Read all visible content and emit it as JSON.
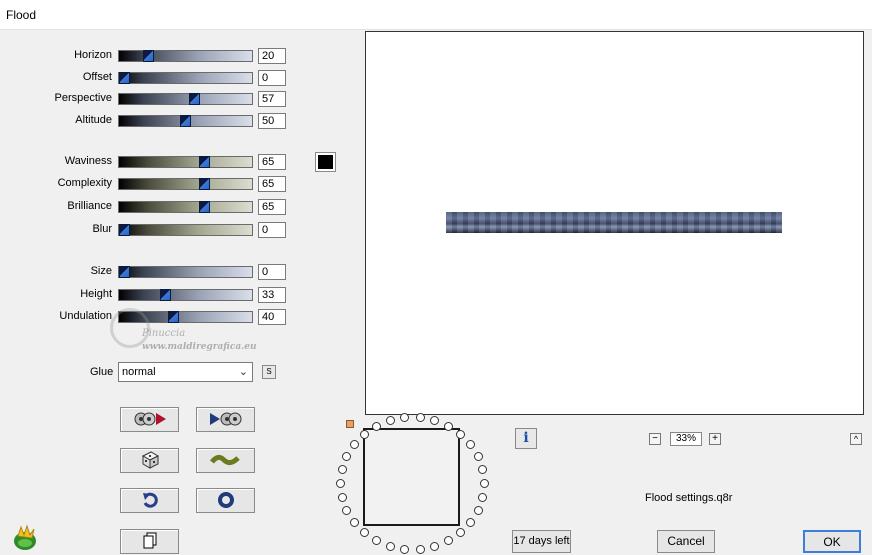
{
  "window": {
    "title": "Flood"
  },
  "sliders_group1": [
    {
      "label": "Horizon",
      "value": "20",
      "style": "blue"
    },
    {
      "label": "Offset",
      "value": "0",
      "style": "blue"
    },
    {
      "label": "Perspective",
      "value": "57",
      "style": "blue"
    },
    {
      "label": "Altitude",
      "value": "50",
      "style": "blue"
    }
  ],
  "sliders_group2": [
    {
      "label": "Waviness",
      "value": "65",
      "style": "olive"
    },
    {
      "label": "Complexity",
      "value": "65",
      "style": "olive"
    },
    {
      "label": "Brilliance",
      "value": "65",
      "style": "olive"
    },
    {
      "label": "Blur",
      "value": "0",
      "style": "olive"
    }
  ],
  "sliders_group3": [
    {
      "label": "Size",
      "value": "0",
      "style": "blue"
    },
    {
      "label": "Height",
      "value": "33",
      "style": "blue"
    },
    {
      "label": "Undulation",
      "value": "40",
      "style": "blue"
    }
  ],
  "color_swatch": "#000000",
  "glue": {
    "label": "Glue",
    "selected": "normal",
    "s_button": "S"
  },
  "watermark": {
    "name": "Pinuccia",
    "url": "www.maldiregrafica.eu"
  },
  "tool_buttons": [
    {
      "icon": "play-reverse-disc-icon"
    },
    {
      "icon": "play-forward-disc-icon"
    },
    {
      "icon": "dice-randomize-icon"
    },
    {
      "icon": "wave-icon"
    },
    {
      "icon": "undo-arrow-icon"
    },
    {
      "icon": "reset-circle-icon"
    },
    {
      "icon": "copy-pages-icon"
    }
  ],
  "zoom": {
    "value": "33%",
    "minus": "−",
    "plus": "+"
  },
  "settings_file": "Flood settings.q8r",
  "trial": {
    "label": "17 days left"
  },
  "buttons": {
    "cancel": "Cancel",
    "ok": "OK"
  },
  "accent_color": "#3c7fd8"
}
